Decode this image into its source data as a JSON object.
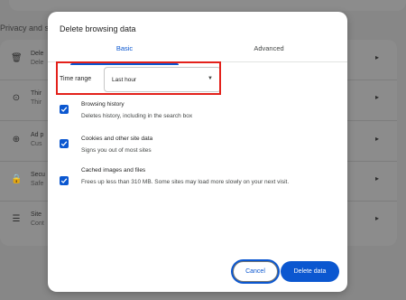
{
  "background": {
    "section_title": "Privacy and s",
    "rows": [
      {
        "icon": "trash-icon",
        "glyph": "🗑",
        "line1": "Dele",
        "line2": "Dele"
      },
      {
        "icon": "cookie-icon",
        "glyph": "⊙",
        "line1": "Thir",
        "line2": "Thir"
      },
      {
        "icon": "ad-privacy-icon",
        "glyph": "⊕",
        "line1": "Ad p",
        "line2": "Cus"
      },
      {
        "icon": "lock-icon",
        "glyph": "🔒",
        "line1": "Secu",
        "line2": "Safe"
      },
      {
        "icon": "site-settings-icon",
        "glyph": "☰",
        "line1": "Site",
        "line2": "Cont"
      }
    ]
  },
  "dialog": {
    "title": "Delete browsing data",
    "tabs": {
      "basic": "Basic",
      "advanced": "Advanced"
    },
    "time_range": {
      "label": "Time range",
      "value": "Last hour"
    },
    "options": [
      {
        "title": "Browsing history",
        "description": "Deletes history, including in the search box",
        "checked": true
      },
      {
        "title": "Cookies and other site data",
        "description": "Signs you out of most sites",
        "checked": true
      },
      {
        "title": "Cached images and files",
        "description": "Frees up less than 310 MB. Some sites may load more slowly on your next visit.",
        "checked": true
      }
    ],
    "buttons": {
      "cancel": "Cancel",
      "delete": "Delete data"
    }
  },
  "colors": {
    "accent": "#0b57d0",
    "highlight": "#e3211b"
  }
}
